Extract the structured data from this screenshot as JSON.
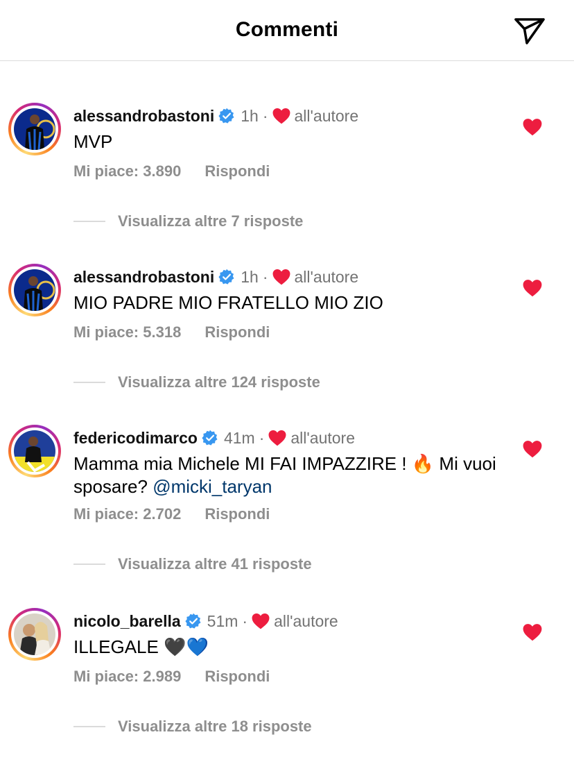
{
  "header": {
    "title": "Commenti",
    "send_icon": "paper-plane-icon"
  },
  "comments": [
    {
      "username": "alessandrobastoni",
      "time": "1h",
      "liked_by_author": "all'autore",
      "text": "MVP",
      "likes": "Mi piace: 3.890",
      "reply": "Rispondi",
      "view_replies": "Visualizza altre 7 risposte"
    },
    {
      "username": "alessandrobastoni",
      "time": "1h",
      "liked_by_author": "all'autore",
      "text": "MIO PADRE MIO FRATELLO MIO ZIO",
      "likes": "Mi piace: 5.318",
      "reply": "Rispondi",
      "view_replies": "Visualizza altre 124 risposte"
    },
    {
      "username": "federicodimarco",
      "time": "41m",
      "liked_by_author": "all'autore",
      "text_part1": "Mamma mia Michele MI FAI IMPAZZIRE ! ",
      "emoji": "🔥",
      "text_part2": " Mi vuoi sposare? ",
      "mention": "@micki_taryan",
      "likes": "Mi piace: 2.702",
      "reply": "Rispondi",
      "view_replies": "Visualizza altre 41 risposte"
    },
    {
      "username": "nicolo_barella",
      "time": "51m",
      "liked_by_author": "all'autore",
      "text": "ILLEGALE ",
      "emoji": "🖤💙",
      "likes": "Mi piace: 2.989",
      "reply": "Rispondi",
      "view_replies": "Visualizza altre 18 risposte"
    }
  ],
  "colors": {
    "heart": "#ed1d3f",
    "verified": "#3897f0",
    "meta": "#737373",
    "mention": "#00376b"
  }
}
